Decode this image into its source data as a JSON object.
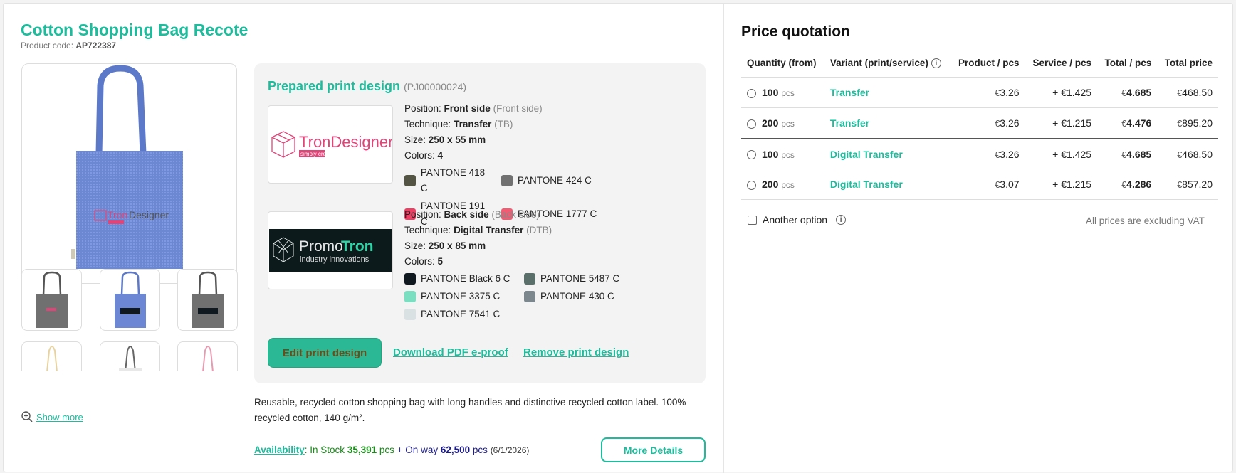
{
  "product": {
    "title": "Cotton Shopping Bag Recote",
    "code_label": "Product code:",
    "code": "AP722387",
    "show_more": "Show more"
  },
  "print_design": {
    "title": "Prepared print design",
    "id": "(PJ00000024)",
    "positions": [
      {
        "logo_brand": "TronDesigner",
        "logo_tagline": "simply create",
        "position_label": "Position:",
        "position": "Front side",
        "position_muted": "(Front side)",
        "technique_label": "Technique:",
        "technique": "Transfer",
        "technique_muted": "(TB)",
        "size_label": "Size:",
        "size": "250 x 55 mm",
        "colors_label": "Colors:",
        "colors_count": "4",
        "colors": [
          {
            "name": "PANTONE 418 C",
            "hex": "#545445"
          },
          {
            "name": "PANTONE 424 C",
            "hex": "#707070"
          },
          {
            "name": "PANTONE 191 C",
            "hex": "#ef3e63"
          },
          {
            "name": "PANTONE 1777 C",
            "hex": "#f45b72"
          }
        ]
      },
      {
        "logo_brand_a": "Promo",
        "logo_brand_b": "Tron",
        "logo_tagline": "industry innovations",
        "position_label": "Position:",
        "position": "Back side",
        "position_muted": "(Back side)",
        "technique_label": "Technique:",
        "technique": "Digital Transfer",
        "technique_muted": "(DTB)",
        "size_label": "Size:",
        "size": "250 x 85 mm",
        "colors_label": "Colors:",
        "colors_count": "5",
        "colors": [
          {
            "name": "PANTONE Black 6 C",
            "hex": "#101820"
          },
          {
            "name": "PANTONE 5487 C",
            "hex": "#5b6f6a"
          },
          {
            "name": "PANTONE 3375 C",
            "hex": "#7adfc0"
          },
          {
            "name": "PANTONE 430 C",
            "hex": "#7c868d"
          },
          {
            "name": "PANTONE 7541 C",
            "hex": "#d9e1e2"
          }
        ]
      }
    ],
    "edit_button": "Edit print design",
    "download_link": "Download PDF e-proof",
    "remove_link": "Remove print design"
  },
  "description": "Reusable, recycled cotton shopping bag with long handles and distinctive recycled cotton label. 100% recycled cotton, 140 g/m².",
  "availability": {
    "label": "Availability",
    "in_stock_label": ": In Stock",
    "in_stock": "35,391",
    "pcs1": "pcs",
    "plus": "+ On way",
    "on_way": "62,500",
    "pcs2": "pcs",
    "date": "(6/1/2026)"
  },
  "more_details": "More Details",
  "quotation": {
    "title": "Price quotation",
    "headers": {
      "qty": "Quantity (from)",
      "variant": "Variant (print/service)",
      "product": "Product / pcs",
      "service": "Service / pcs",
      "total_pcs": "Total / pcs",
      "total": "Total price"
    },
    "rows": [
      {
        "qty": "100",
        "unit": "pcs",
        "variant": "Transfer",
        "cur": "€",
        "product": "3.26",
        "service_prefix": "+ €",
        "service": "1.425",
        "total_pcs": "4.685",
        "total": "468.50"
      },
      {
        "qty": "200",
        "unit": "pcs",
        "variant": "Transfer",
        "cur": "€",
        "product": "3.26",
        "service_prefix": "+ €",
        "service": "1.215",
        "total_pcs": "4.476",
        "total": "895.20"
      },
      {
        "qty": "100",
        "unit": "pcs",
        "variant": "Digital Transfer",
        "cur": "€",
        "product": "3.26",
        "service_prefix": "+ €",
        "service": "1.425",
        "total_pcs": "4.685",
        "total": "468.50"
      },
      {
        "qty": "200",
        "unit": "pcs",
        "variant": "Digital Transfer",
        "cur": "€",
        "product": "3.07",
        "service_prefix": "+ €",
        "service": "1.215",
        "total_pcs": "4.286",
        "total": "857.20"
      }
    ],
    "another_option": "Another option",
    "vat_note": "All prices are excluding VAT"
  }
}
